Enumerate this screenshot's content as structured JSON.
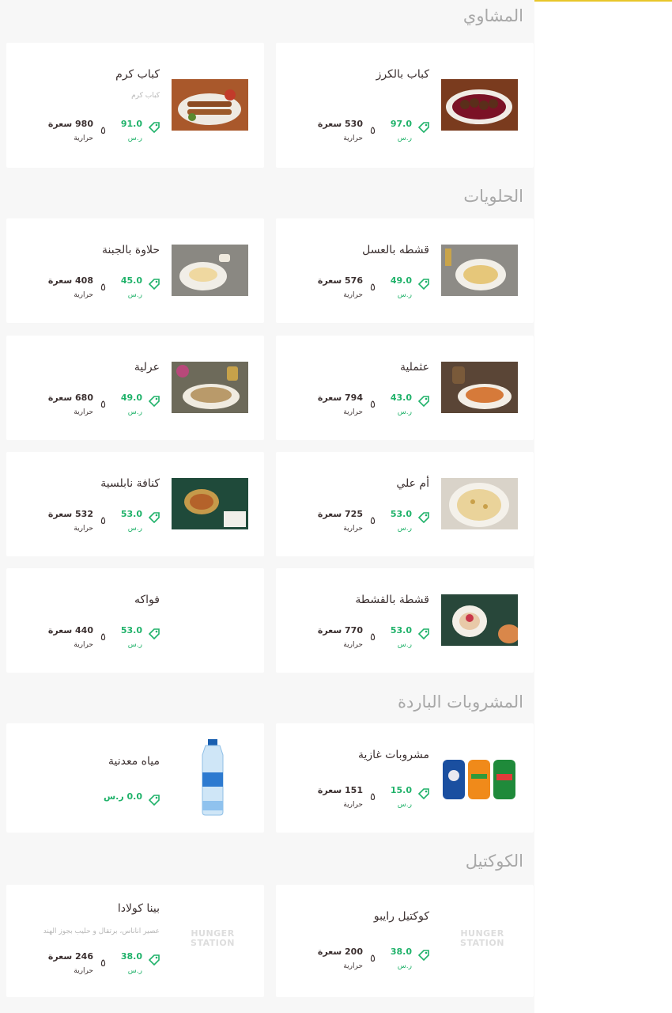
{
  "sections": [
    {
      "title": "المشاوي"
    },
    {
      "title": "الحلويات"
    },
    {
      "title": "المشروبات الباردة"
    },
    {
      "title": "الكوكتيل"
    }
  ],
  "items": [
    {
      "name": "كباب بالكرز",
      "desc": "",
      "price": "97.0",
      "unit": "ر.س",
      "calories": "530 سعرة",
      "cal_label": "حرارية",
      "image": "kebab-cherry"
    },
    {
      "name": "كباب كرم",
      "desc": "كباب كرم",
      "price": "91.0",
      "unit": "ر.س",
      "calories": "980 سعرة",
      "cal_label": "حرارية",
      "image": "kebab-karam"
    },
    {
      "name": "قشطه بالعسل",
      "desc": "",
      "price": "49.0",
      "unit": "ر.س",
      "calories": "576 سعرة",
      "cal_label": "حرارية",
      "image": "qashta-honey"
    },
    {
      "name": "حلاوة بالجبنة",
      "desc": "",
      "price": "45.0",
      "unit": "ر.س",
      "calories": "408 سعرة",
      "cal_label": "حرارية",
      "image": "halawa-cheese"
    },
    {
      "name": "عثملية",
      "desc": "",
      "price": "43.0",
      "unit": "ر.س",
      "calories": "794 سعرة",
      "cal_label": "حرارية",
      "image": "othmalia"
    },
    {
      "name": "عرلية",
      "desc": "",
      "price": "49.0",
      "unit": "ر.س",
      "calories": "680 سعرة",
      "cal_label": "حرارية",
      "image": "arlia"
    },
    {
      "name": "أم علي",
      "desc": "",
      "price": "53.0",
      "unit": "ر.س",
      "calories": "725 سعرة",
      "cal_label": "حرارية",
      "image": "om-ali"
    },
    {
      "name": "كنافة نابلسية",
      "desc": "",
      "price": "53.0",
      "unit": "ر.س",
      "calories": "532 سعرة",
      "cal_label": "حرارية",
      "image": "kunafa"
    },
    {
      "name": "قشطة بالقشطة",
      "desc": "",
      "price": "53.0",
      "unit": "ر.س",
      "calories": "770 سعرة",
      "cal_label": "حرارية",
      "image": "qashta-cream"
    },
    {
      "name": "فواكه",
      "desc": "",
      "price": "53.0",
      "unit": "ر.س",
      "calories": "440 سعرة",
      "cal_label": "حرارية",
      "image": ""
    },
    {
      "name": "مشروبات غازية",
      "desc": "",
      "price": "15.0",
      "unit": "ر.س",
      "calories": "151 سعرة",
      "cal_label": "حرارية",
      "image": "soft-drinks"
    },
    {
      "name": "مياه معدنية",
      "desc": "",
      "price": "0.0 ر.س",
      "unit": "",
      "calories": "",
      "cal_label": "",
      "image": "water-bottle"
    },
    {
      "name": "كوكتيل رايبو",
      "desc": "",
      "price": "38.0",
      "unit": "ر.س",
      "calories": "200 سعرة",
      "cal_label": "حرارية",
      "image": "hungerstation-logo"
    },
    {
      "name": "بينا كولادا",
      "desc": "عصير اناناس، برتقال و حليب بجوز الهند",
      "price": "38.0",
      "unit": "ر.س",
      "calories": "246 سعرة",
      "cal_label": "حرارية",
      "image": "hungerstation-logo"
    }
  ],
  "placeholder_logo_text": [
    "HUNGER",
    "STATION"
  ],
  "colors": {
    "accent_yellow": "#e8c62a",
    "price_green": "#20b26a",
    "text_dark": "#3b3030",
    "section_gray": "#a8a8a8"
  }
}
